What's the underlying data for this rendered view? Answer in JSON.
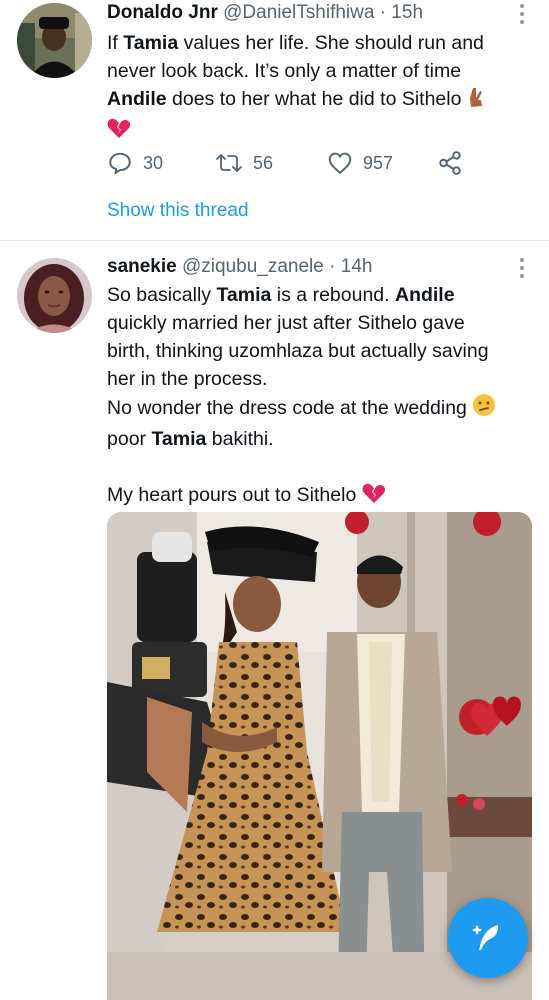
{
  "tweet1": {
    "author_name": "Donaldo Jnr",
    "handle": "@DanielTshifhiwa",
    "time": "· 15h",
    "lines": [
      [
        "If ",
        "Tamia",
        " values her life. She should run and"
      ],
      [
        "never look back. It’s only a matter of time"
      ],
      [
        "",
        "Andile",
        " does to her what he did to Sithelo"
      ]
    ],
    "replies": "30",
    "retweets": "56",
    "likes": "957",
    "show_thread": "Show this thread"
  },
  "tweet2": {
    "author_name": "sanekie",
    "handle": "@ziqubu_zanele",
    "time": "· 14h",
    "lines": [
      [
        "So basically ",
        "Tamia",
        " is a rebound. ",
        "Andile"
      ],
      [
        "quickly married her just after Sithelo gave"
      ],
      [
        "birth, thinking uzomhlaza but actually saving"
      ],
      [
        "her in the process."
      ],
      [
        "No wonder the dress code at the wedding"
      ],
      [
        "poor ",
        "Tamia",
        " bakithi."
      ],
      [
        ""
      ],
      [
        "My heart pours out to Sithelo"
      ]
    ]
  },
  "icons": {
    "reply": "reply-icon",
    "retweet": "retweet-icon",
    "like": "heart-icon",
    "share": "share-icon",
    "compose": "compose-icon",
    "broken_heart": "broken-heart-emoji",
    "fingers_crossed": "crossed-fingers-emoji",
    "confused": "confused-face-emoji"
  },
  "colors": {
    "accent": "#1d9bf0",
    "secondary_text": "#536471",
    "broken_heart": "#e0245e"
  }
}
